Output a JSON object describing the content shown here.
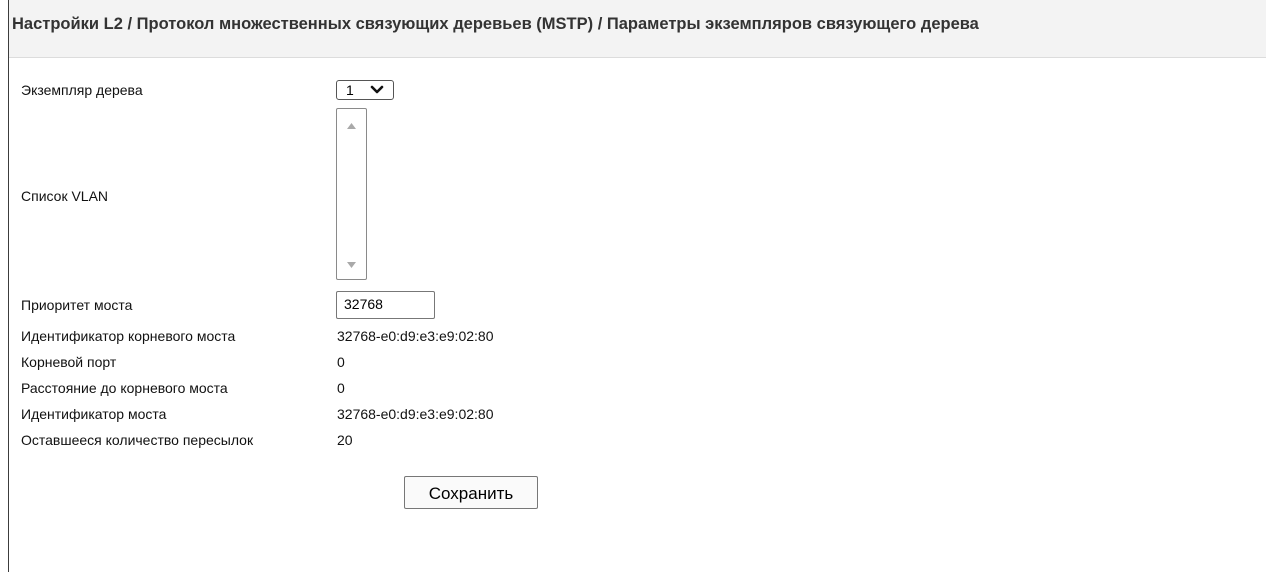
{
  "header": {
    "title": "Настройки L2 / Протокол множественных связующих деревьев (MSTP) / Параметры экземпляров связующего дерева"
  },
  "form": {
    "instance_label": "Экземпляр дерева",
    "instance_value": "1",
    "vlan_list_label": "Список VLAN",
    "bridge_priority_label": "Приоритет моста",
    "bridge_priority_value": "32768",
    "root_bridge_id_label": "Идентификатор корневого моста",
    "root_bridge_id_value": "32768-e0:d9:e3:e9:02:80",
    "root_port_label": "Корневой порт",
    "root_port_value": "0",
    "root_path_cost_label": "Расстояние до корневого моста",
    "root_path_cost_value": "0",
    "bridge_id_label": "Идентификатор моста",
    "bridge_id_value": "32768-e0:d9:e3:e9:02:80",
    "remaining_hops_label": "Оставшееся количество пересылок",
    "remaining_hops_value": "20",
    "save_label": "Сохранить"
  },
  "icons": {
    "dropdown": "chevron-down-icon",
    "scroll_up": "scroll-up-arrow-icon",
    "scroll_down": "scroll-down-arrow-icon"
  }
}
